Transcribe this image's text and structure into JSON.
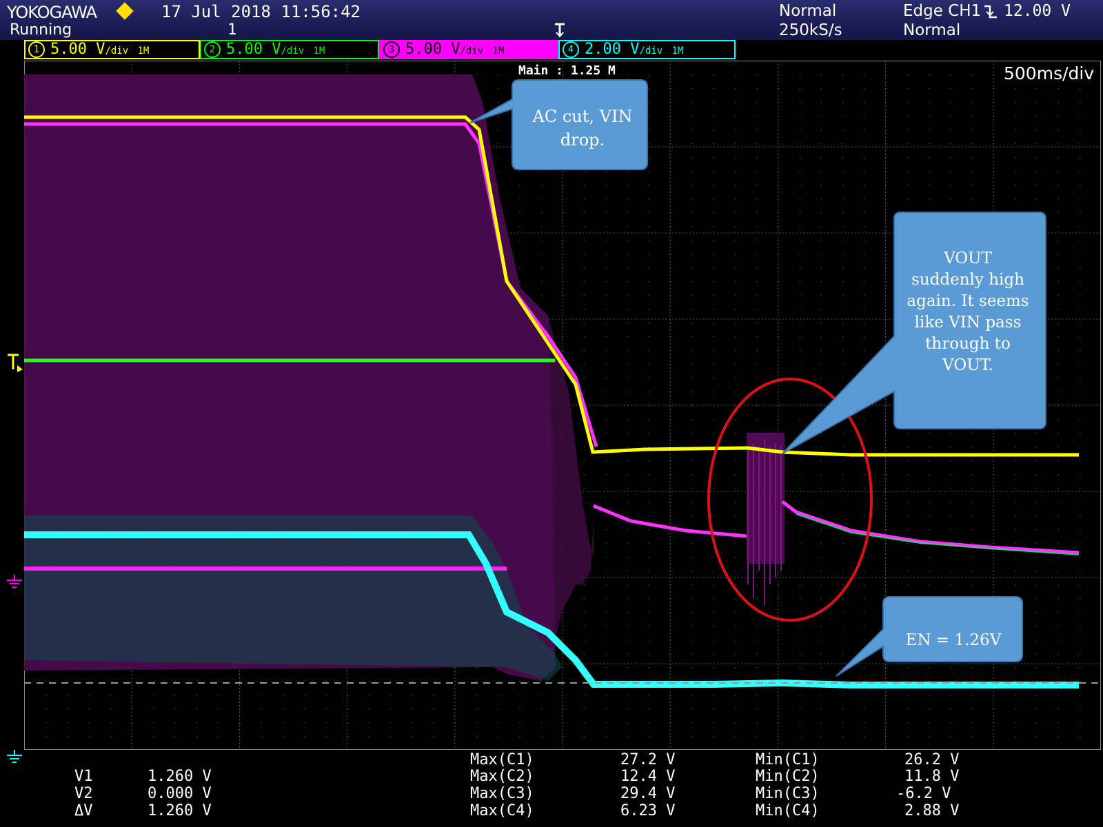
{
  "header": {
    "brand": "YOKOGAWA",
    "datetime": "17 Jul 2018 11:56:42",
    "status": "Running",
    "acq_count": "1",
    "acq_mode": "Normal",
    "sample_rate": "250kS/s",
    "trigger": "Edge CH1",
    "trigger_level": "12.00 V",
    "trigger_mode": "Normal",
    "trigger_slope_icon": "falling-edge-icon",
    "trigger_pos_icon": "trigger-position-icon"
  },
  "channels": [
    {
      "num": "1",
      "scale": "5.00 V",
      "unit": "/div",
      "bw": "1M",
      "color": "#ffff00"
    },
    {
      "num": "2",
      "scale": "5.00 V",
      "unit": "/div",
      "bw": "1M",
      "color": "#00ff00"
    },
    {
      "num": "3",
      "scale": "5.00 V",
      "unit": "/div",
      "bw": "1M",
      "color": "#ff00ff"
    },
    {
      "num": "4",
      "scale": "2.00 V",
      "unit": "/div",
      "bw": "1M",
      "color": "#00ffff"
    }
  ],
  "screen": {
    "main": "Main : 1.25 M",
    "timebase": "500ms/div"
  },
  "cursors": [
    {
      "label": "V1",
      "value": "1.260 V"
    },
    {
      "label": "V2",
      "value": "0.000 V"
    },
    {
      "label": "ΔV",
      "value": "1.260 V"
    }
  ],
  "measurements": [
    {
      "max_label": "Max(C1)",
      "max_value": "27.2 V",
      "min_label": "Min(C1)",
      "min_value": "26.2 V"
    },
    {
      "max_label": "Max(C2)",
      "max_value": "12.4 V",
      "min_label": "Min(C2)",
      "min_value": "11.8 V"
    },
    {
      "max_label": "Max(C3)",
      "max_value": "29.4 V",
      "min_label": "Min(C3)",
      "min_value": "-6.2 V"
    },
    {
      "max_label": "Max(C4)",
      "max_value": "6.23 V",
      "min_label": "Min(C4)",
      "min_value": "2.88 V"
    }
  ],
  "annotations": {
    "ac_cut": "AC cut, VIN drop.",
    "vout_high": "VOUT suddenly high again. It seems like VIN pass through to VOUT.",
    "en_value": "EN = 1.26V"
  }
}
